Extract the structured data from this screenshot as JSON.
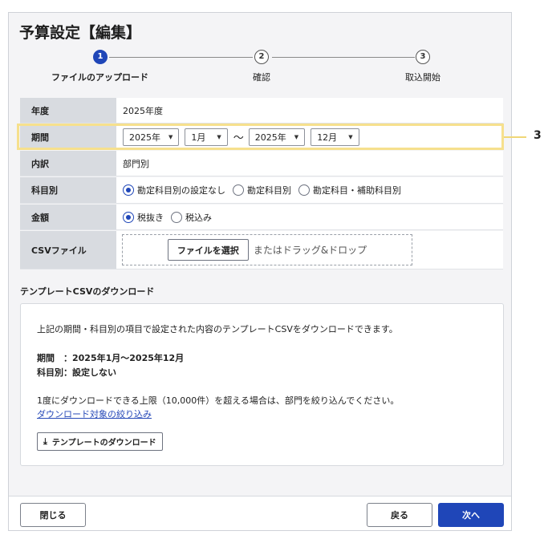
{
  "title": "予算設定【編集】",
  "stepper": {
    "steps": [
      {
        "number": "1",
        "label": "ファイルのアップロード",
        "state": "active"
      },
      {
        "number": "2",
        "label": "確認",
        "state": "todo"
      },
      {
        "number": "3",
        "label": "取込開始",
        "state": "todo"
      }
    ]
  },
  "form": {
    "year": {
      "label": "年度",
      "value": "2025年度"
    },
    "period": {
      "label": "期間",
      "start_year": "2025年",
      "start_month": "1月",
      "separator": "～",
      "end_year": "2025年",
      "end_month": "12月"
    },
    "breakdown": {
      "label": "内訳",
      "value": "部門別"
    },
    "account": {
      "label": "科目別",
      "options": [
        "勘定科目別の設定なし",
        "勘定科目別",
        "勘定科目・補助科目別"
      ],
      "selected": "勘定科目別の設定なし"
    },
    "amount": {
      "label": "金額",
      "options": [
        "税抜き",
        "税込み"
      ],
      "selected": "税抜き"
    },
    "csv": {
      "label": "CSVファイル",
      "button": "ファイルを選択",
      "drop_text": "またはドラッグ&ドロップ"
    }
  },
  "callout": {
    "number": "3"
  },
  "template": {
    "section_title": "テンプレートCSVのダウンロード",
    "description": "上記の期間・科目別の項目で設定された内容のテンプレートCSVをダウンロードできます。",
    "period_line": "期間　：2025年1月～2025年12月",
    "account_line": "科目別：設定しない",
    "limit_note": "1度にダウンロードできる上限（10,000件）を超える場合は、部門を絞り込んでください。",
    "filter_link": "ダウンロード対象の絞り込み",
    "download_button": "テンプレートのダウンロード",
    "download_icon": "download-icon"
  },
  "footer": {
    "close": "閉じる",
    "back": "戻る",
    "next": "次へ"
  },
  "colors": {
    "primary": "#1f46b8",
    "highlight": "#f6e08d",
    "label_bg": "#d8dbe0"
  }
}
